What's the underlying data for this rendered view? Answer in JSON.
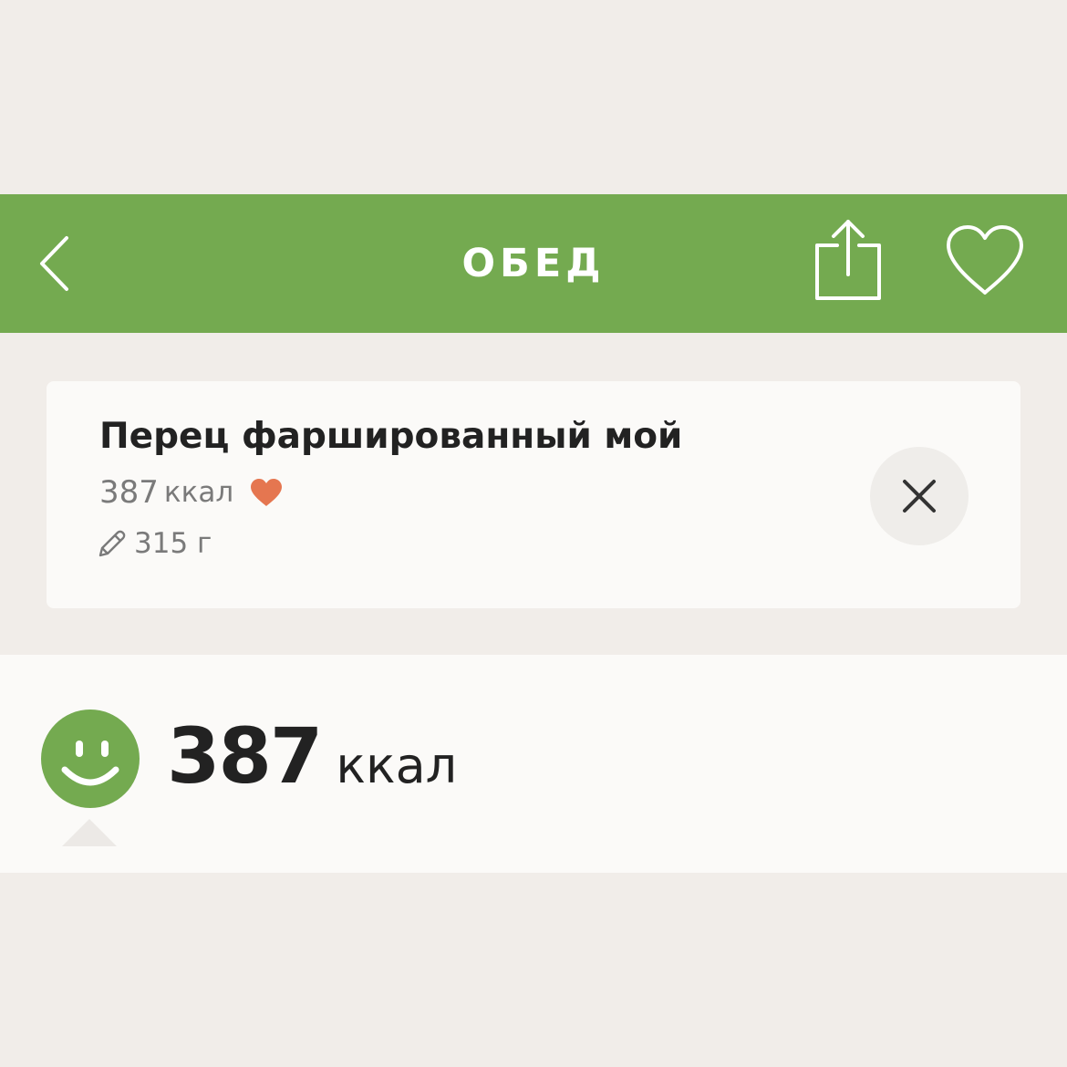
{
  "header": {
    "title": "ОБЕД",
    "background_color": "#74aa50",
    "back_icon": "chevron-left-icon",
    "share_icon": "share-icon",
    "favorite_icon": "heart-outline-icon"
  },
  "meal_item": {
    "name": "Перец фаршированный мой",
    "kcal_value": "387",
    "kcal_unit": "ккал",
    "is_favorite": true,
    "favorite_color": "#e57650",
    "edit_icon": "pencil-icon",
    "weight": "315 г",
    "remove_icon": "close-icon"
  },
  "summary": {
    "kcal_value": "387",
    "kcal_unit": "ккал",
    "status_icon": "smiley-icon",
    "status_color": "#74aa50"
  }
}
